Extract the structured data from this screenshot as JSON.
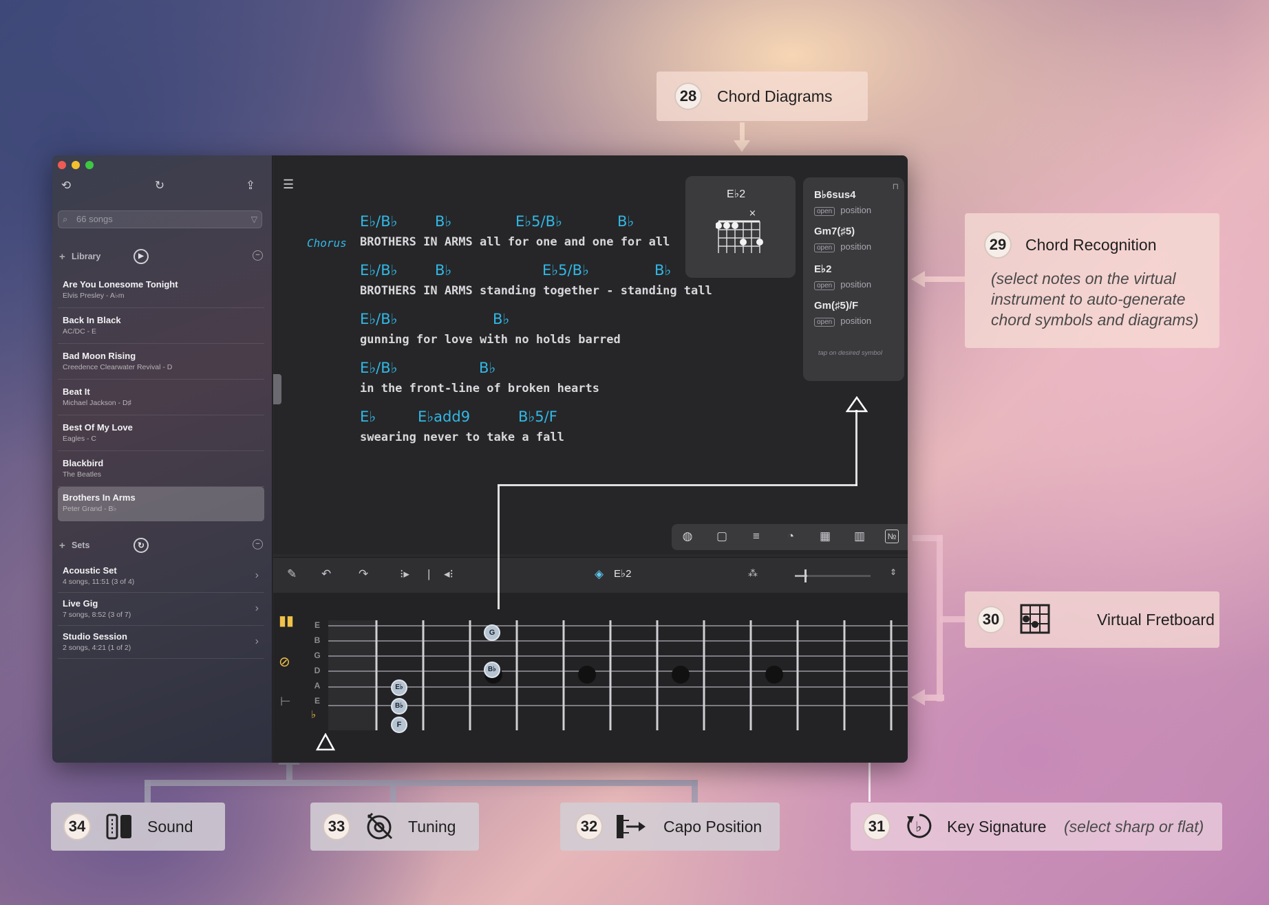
{
  "callouts": {
    "c28": {
      "num": "28",
      "label": "Chord Diagrams"
    },
    "c29": {
      "num": "29",
      "label": "Chord Recognition",
      "hint": "(select notes on the virtual instrument to auto-generate chord symbols and diagrams)"
    },
    "c30": {
      "num": "30",
      "label": "Virtual Fretboard"
    },
    "c31": {
      "num": "31",
      "label": "Key Signature",
      "hint": "(select sharp or flat)"
    },
    "c32": {
      "num": "32",
      "label": "Capo Position"
    },
    "c33": {
      "num": "33",
      "label": "Tuning"
    },
    "c34": {
      "num": "34",
      "label": "Sound"
    }
  },
  "sidebar": {
    "search_placeholder": "66 songs",
    "library_label": "Library",
    "sets_label": "Sets",
    "songs": [
      {
        "title": "Are You Lonesome Tonight",
        "sub": "Elvis Presley - A♭m"
      },
      {
        "title": "Back In Black",
        "sub": "AC/DC - E"
      },
      {
        "title": "Bad Moon Rising",
        "sub": "Creedence Clearwater Revival - D"
      },
      {
        "title": "Beat It",
        "sub": "Michael Jackson - D♯"
      },
      {
        "title": "Best Of My Love",
        "sub": "Eagles - C"
      },
      {
        "title": "Blackbird",
        "sub": "The Beatles"
      },
      {
        "title": "Brothers In Arms",
        "sub": "Peter Grand - B♭"
      }
    ],
    "sets": [
      {
        "title": "Acoustic Set",
        "sub": "4 songs, 11:51 (3 of 4)"
      },
      {
        "title": "Live Gig",
        "sub": "7 songs, 8:52 (3 of 7)"
      },
      {
        "title": "Studio Session",
        "sub": "2 songs, 4:21 (1 of 2)"
      }
    ]
  },
  "editor": {
    "section_label": "Chorus",
    "lines": [
      {
        "chords": [
          "E♭/B♭",
          "B♭",
          "E♭5/B♭",
          "B♭"
        ],
        "lyric": "BROTHERS IN ARMS all for one and one for all"
      },
      {
        "chords": [
          "E♭/B♭",
          "B♭",
          "E♭5/B♭",
          "B♭"
        ],
        "lyric": "BROTHERS IN ARMS standing together - standing tall"
      },
      {
        "chords": [
          "E♭/B♭",
          "B♭"
        ],
        "lyric": "gunning for love with no holds barred"
      },
      {
        "chords": [
          "E♭/B♭",
          "B♭"
        ],
        "lyric": "in the front-line of broken hearts"
      },
      {
        "chords": [
          "E♭",
          "E♭add9",
          "B♭5/F"
        ],
        "lyric": "swearing never to take a fall"
      }
    ],
    "diagram_chord": "E♭2",
    "recognition": [
      {
        "name": "B♭6sus4",
        "open": "open",
        "position": "position"
      },
      {
        "name": "Gm7(♯5)",
        "open": "open",
        "position": "position"
      },
      {
        "name": "E♭2",
        "open": "open",
        "position": "position"
      },
      {
        "name": "Gm(♯5)/F",
        "open": "open",
        "position": "position"
      }
    ],
    "recognition_hint": "tap on desired symbol"
  },
  "fretboard": {
    "current_chord": "E♭2",
    "strings": [
      "E",
      "B",
      "G",
      "D",
      "A",
      "E"
    ],
    "notes": [
      "G",
      "B♭",
      "E♭",
      "B♭",
      "F"
    ]
  }
}
